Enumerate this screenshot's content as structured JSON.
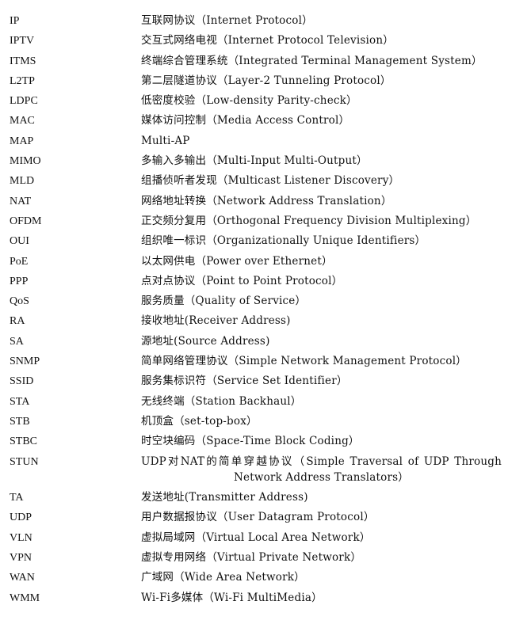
{
  "glossary": {
    "rows": [
      {
        "abbr": "IP",
        "definition": "互联网协议（Internet Protocol）"
      },
      {
        "abbr": "IPTV",
        "definition": "交互式网络电视（Internet Protocol Television）"
      },
      {
        "abbr": "ITMS",
        "definition": "终端综合管理系统（Integrated Terminal Management System）"
      },
      {
        "abbr": "L2TP",
        "definition": "第二层隧道协议（Layer-2 Tunneling Protocol）"
      },
      {
        "abbr": "LDPC",
        "definition": "低密度校验（Low-density Parity-check）"
      },
      {
        "abbr": "MAC",
        "definition": "媒体访问控制（Media Access Control）"
      },
      {
        "abbr": "MAP",
        "definition": "Multi-AP"
      },
      {
        "abbr": "MIMO",
        "definition": "多输入多输出（Multi-Input Multi-Output）"
      },
      {
        "abbr": "MLD",
        "definition": "组播侦听者发现（Multicast Listener Discovery）"
      },
      {
        "abbr": "NAT",
        "definition": "网络地址转换（Network Address Translation）"
      },
      {
        "abbr": "OFDM",
        "definition": "正交频分复用（Orthogonal Frequency Division Multiplexing）"
      },
      {
        "abbr": "OUI",
        "definition": "组织唯一标识（Organizationally Unique Identifiers）"
      },
      {
        "abbr": "PoE",
        "definition": "以太网供电（Power over Ethernet）"
      },
      {
        "abbr": "PPP",
        "definition": "点对点协议（Point to Point Protocol）"
      },
      {
        "abbr": "QoS",
        "definition": "服务质量（Quality of Service）"
      },
      {
        "abbr": "RA",
        "definition": "接收地址(Receiver Address)"
      },
      {
        "abbr": "SA",
        "definition": "源地址(Source Address)"
      },
      {
        "abbr": "SNMP",
        "definition": "简单网络管理协议（Simple Network Management Protocol）"
      },
      {
        "abbr": "SSID",
        "definition": "服务集标识符（Service Set Identifier）"
      },
      {
        "abbr": "STA",
        "definition": "无线终端（Station Backhaul）"
      },
      {
        "abbr": "STB",
        "definition": "机顶盒（set-top-box）"
      },
      {
        "abbr": "STBC",
        "definition": "时空块编码（Space-Time Block Coding）"
      },
      {
        "abbr": "STUN",
        "definition": "UDP对NAT的简单穿越协议（Simple Traversal of UDP Through Network Address Translators）"
      },
      {
        "abbr": "TA",
        "definition": "发送地址(Transmitter Address)"
      },
      {
        "abbr": "UDP",
        "definition": "用户数据报协议（User Datagram Protocol）"
      },
      {
        "abbr": "VLN",
        "definition": "虚拟局域网（Virtual Local Area Network）"
      },
      {
        "abbr": "VPN",
        "definition": "虚拟专用网络（Virtual Private Network）"
      },
      {
        "abbr": "WAN",
        "definition": "广域网（Wide Area Network）"
      },
      {
        "abbr": "WMM",
        "definition": "Wi-Fi多媒体（Wi-Fi MultiMedia）"
      }
    ]
  }
}
